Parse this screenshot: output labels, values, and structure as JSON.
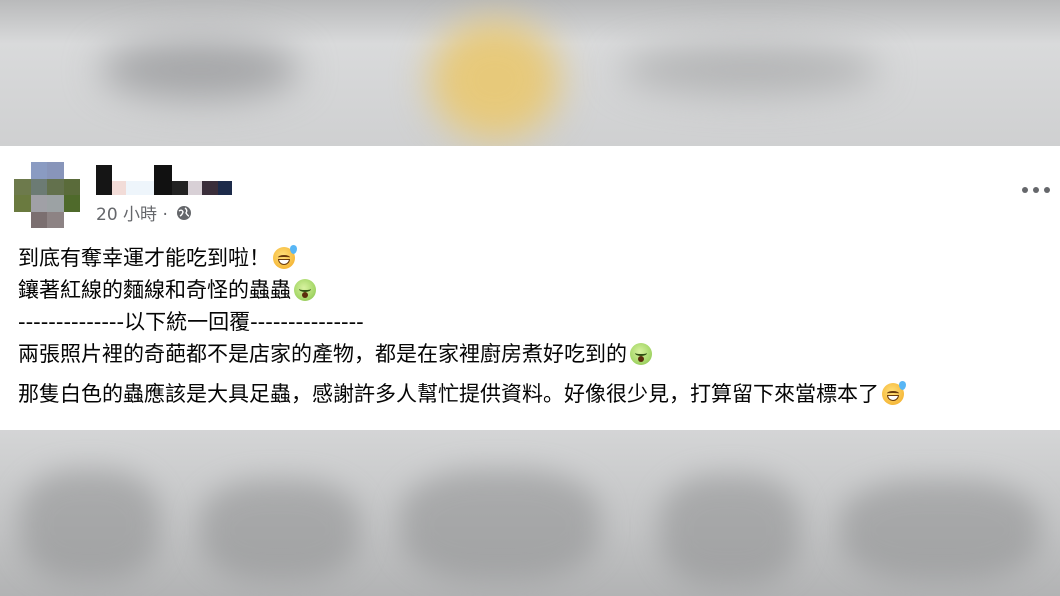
{
  "post": {
    "timestamp": "20 小時 ·",
    "icons": {
      "audience": "globe-icon",
      "menu": "more-icon",
      "emoji1": "grinning-sweat-emoji",
      "emoji2": "nauseated-emoji"
    },
    "lines": [
      "到底有奪幸運才能吃到啦！",
      "鑲著紅線的麵線和奇怪的蟲蟲",
      "--------------以下統一回覆---------------",
      "兩張照片裡的奇葩都不是店家的產物，都是在家裡廚房煮好吃到的",
      "那隻白色的蟲應該是大具足蟲，感謝許多人幫忙提供資料。好像很少見，打算留下來當標本了"
    ]
  },
  "colors": {
    "text": "#050505",
    "meta": "#65676b",
    "card": "#ffffff",
    "blur_bg": "#c9cacc"
  }
}
